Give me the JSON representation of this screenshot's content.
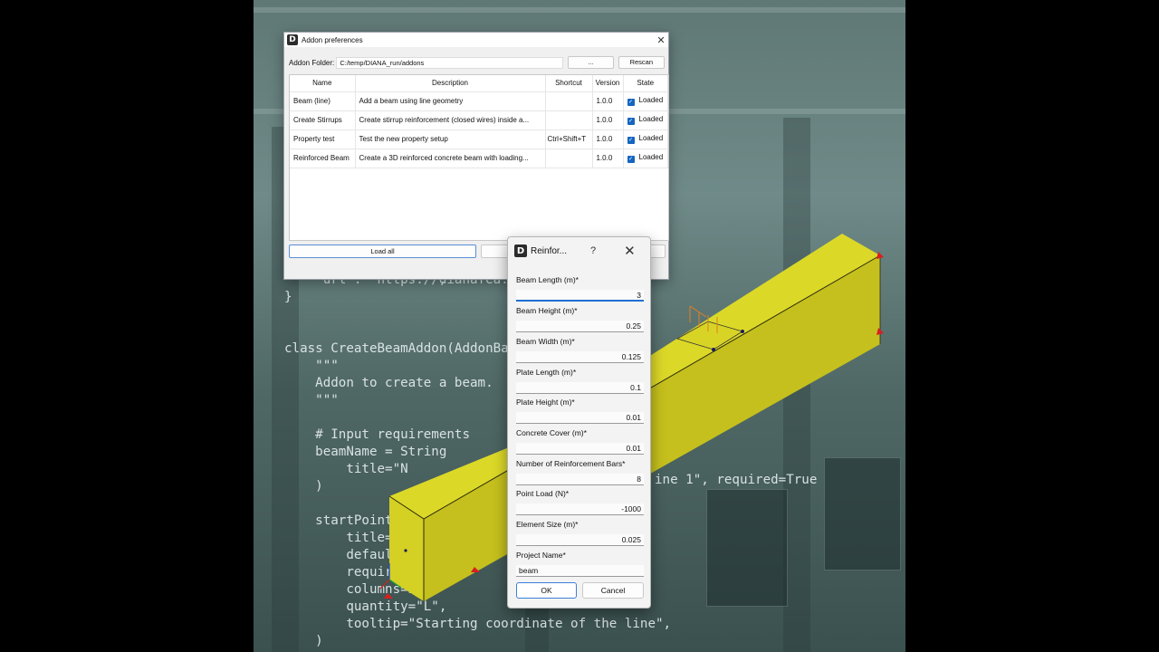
{
  "code_lines": [
    "    \"url\": \"https://dianafea.",
    "}",
    "",
    "",
    "class CreateBeamAddon(AddonBa",
    "    \"\"\"",
    "    Addon to create a beam.",
    "    \"\"\"",
    "",
    "    # Input requirements",
    "    beamName = String",
    "        title=\"N",
    "    )",
    "",
    "    startPoint",
    "        title=",
    "        defaul",
    "        requir",
    "        columns=3,",
    "        quantity=\"L\",",
    "        tooltip=\"Starting coordinate of the line\",",
    "    )"
  ],
  "code_fragments": {
    "line1_tail": "\",",
    "required_tail": "ine 1\", required=True"
  },
  "addon_window": {
    "title": "Addon preferences",
    "folder_label": "Addon Folder:",
    "folder_path": "C:/temp/DIANA_run/addons",
    "browse_label": "...",
    "rescan_label": "Rescan",
    "columns": [
      "Name",
      "Description",
      "Shortcut",
      "Version",
      "State"
    ],
    "rows": [
      {
        "name": "Beam (line)",
        "description": "Add a beam using line geometry",
        "shortcut": "",
        "version": "1.0.0",
        "state": "Loaded"
      },
      {
        "name": "Create Stirrups",
        "description": "Create stirrup reinforcement (closed wires) inside a...",
        "shortcut": "",
        "version": "1.0.0",
        "state": "Loaded"
      },
      {
        "name": "Property test",
        "description": "Test the new property setup",
        "shortcut": "Ctrl+Shift+T",
        "version": "1.0.0",
        "state": "Loaded"
      },
      {
        "name": "Reinforced Beam",
        "description": "Create a 3D reinforced concrete beam with loading...",
        "shortcut": "",
        "version": "1.0.0",
        "state": "Loaded"
      }
    ],
    "load_all_label": "Load all"
  },
  "dialog": {
    "title": "Reinfor...",
    "help_label": "?",
    "close_label": "✕",
    "fields": [
      {
        "label": "Beam Length (m)*",
        "value": "3"
      },
      {
        "label": "Beam Height (m)*",
        "value": "0.25"
      },
      {
        "label": "Beam Width (m)*",
        "value": "0.125"
      },
      {
        "label": "Plate Length (m)*",
        "value": "0.1"
      },
      {
        "label": "Plate Height (m)*",
        "value": "0.01"
      },
      {
        "label": "Concrete Cover (m)*",
        "value": "0.01"
      },
      {
        "label": "Number of Reinforcement Bars*",
        "value": "8"
      },
      {
        "label": "Point Load (N)*",
        "value": "-1000"
      },
      {
        "label": "Element Size (m)*",
        "value": "0.025"
      },
      {
        "label": "Project Name*",
        "value": "beam"
      }
    ],
    "ok_label": "OK",
    "cancel_label": "Cancel"
  },
  "colors": {
    "beam_front": "#c9c41f",
    "beam_top": "#e0dc2a",
    "beam_side": "#b7b21a",
    "accent": "#1f6fd1"
  },
  "icons": [
    "diana-logo-icon",
    "close-icon",
    "help-icon",
    "checkbox-checked-icon"
  ]
}
